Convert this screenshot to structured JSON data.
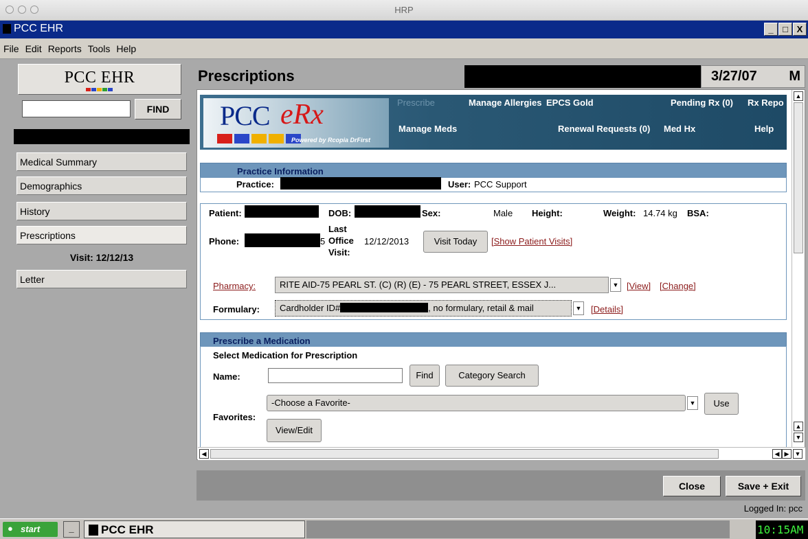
{
  "mac_window": {
    "title": "HRP"
  },
  "app": {
    "title": "PCC EHR",
    "window_buttons": [
      "_",
      "□",
      "X"
    ]
  },
  "menu": [
    "File",
    "Edit",
    "Reports",
    "Tools",
    "Help"
  ],
  "sidebar": {
    "logo_text": "PCC EHR",
    "find_label": "FIND",
    "items": [
      {
        "label": "Medical Summary"
      },
      {
        "label": "Demographics"
      },
      {
        "label": "History"
      },
      {
        "label": "Prescriptions"
      },
      {
        "label": "Letter"
      }
    ],
    "visit_label": "Visit: 12/12/13"
  },
  "header": {
    "title": "Prescriptions",
    "date": "3/27/07",
    "sex": "M"
  },
  "erx": {
    "logo_pcc": "PCC",
    "logo_erx": "eRx",
    "powered_by": "Powered by Rcopia DrFirst",
    "nav": {
      "prescribe": "Prescribe",
      "manage_allergies": "Manage Allergies",
      "epcs_gold": "EPCS Gold",
      "pending_rx": "Pending Rx (0)",
      "rx_report": "Rx Repo",
      "manage_meds": "Manage Meds",
      "renewal_requests": "Renewal Requests (0)",
      "med_hx": "Med Hx",
      "help": "Help"
    },
    "practice": {
      "header": "Practice Information",
      "practice_label": "Practice:",
      "user_label": "User:",
      "user_value": "PCC Support"
    },
    "patient": {
      "patient_label": "Patient:",
      "dob_label": "DOB:",
      "sex_label": "Sex:",
      "sex_value": "Male",
      "height_label": "Height:",
      "weight_label": "Weight:",
      "weight_value": "14.74 kg",
      "bsa_label": "BSA:",
      "phone_label": "Phone:",
      "phone_suffix": "5",
      "last_visit_label_1": "Last",
      "last_visit_label_2": "Office",
      "last_visit_label_3": "Visit:",
      "last_visit_value": "12/12/2013",
      "visit_today": "Visit Today",
      "show_visits": "[Show Patient Visits]",
      "pharmacy_label": "Pharmacy:",
      "pharmacy_value": "RITE AID-75 PEARL ST. (C) (R) (E) - 75 PEARL STREET, ESSEX J...",
      "view_link": "[View]",
      "change_link": "[Change]",
      "formulary_label": "Formulary:",
      "formulary_prefix": "Cardholder ID#",
      "formulary_suffix": ", no formulary, retail & mail",
      "details_link": "[Details]"
    },
    "prescribe": {
      "header": "Prescribe a Medication",
      "subheader": "Select Medication for Prescription",
      "name_label": "Name:",
      "find_btn": "Find",
      "category_btn": "Category Search",
      "favorites_label": "Favorites:",
      "favorite_select": "-Choose a Favorite-",
      "use_btn": "Use",
      "view_edit_btn": "View/Edit"
    }
  },
  "bottom": {
    "close": "Close",
    "save_exit": "Save + Exit",
    "logged_in": "Logged In: pcc"
  },
  "taskbar": {
    "start": "start",
    "minimize": "_",
    "app": "PCC EHR",
    "clock": "10:15AM"
  }
}
